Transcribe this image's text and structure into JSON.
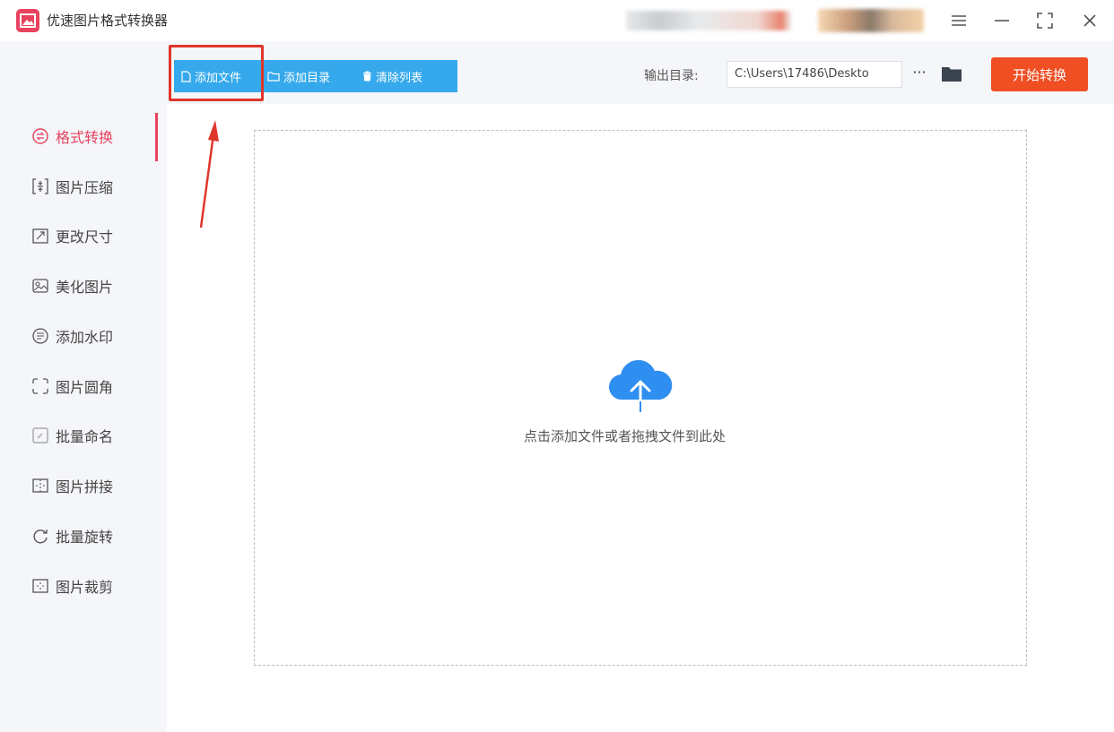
{
  "app": {
    "title": "优速图片格式转换器"
  },
  "toolbar": {
    "add_file": "添加文件",
    "add_folder": "添加目录",
    "clear_list": "清除列表",
    "output_label": "输出目录:",
    "output_path": "C:\\Users\\17486\\Deskto",
    "more": "···",
    "start": "开始转换"
  },
  "sidebar": {
    "items": [
      {
        "label": "格式转换",
        "icon": "format-convert-icon",
        "active": true
      },
      {
        "label": "图片压缩",
        "icon": "compress-icon"
      },
      {
        "label": "更改尺寸",
        "icon": "resize-icon"
      },
      {
        "label": "美化图片",
        "icon": "beautify-icon"
      },
      {
        "label": "添加水印",
        "icon": "watermark-icon"
      },
      {
        "label": "图片圆角",
        "icon": "round-corner-icon"
      },
      {
        "label": "批量命名",
        "icon": "rename-icon"
      },
      {
        "label": "图片拼接",
        "icon": "stitch-icon"
      },
      {
        "label": "批量旋转",
        "icon": "rotate-icon"
      },
      {
        "label": "图片裁剪",
        "icon": "crop-icon"
      }
    ]
  },
  "main": {
    "drop_hint": "点击添加文件或者拖拽文件到此处"
  },
  "colors": {
    "accent": "#e8425e",
    "toolbar_blue": "#35a9ec",
    "start_orange": "#f04e23",
    "highlight_red": "#e0352b",
    "cloud_blue": "#2f8ff0"
  }
}
